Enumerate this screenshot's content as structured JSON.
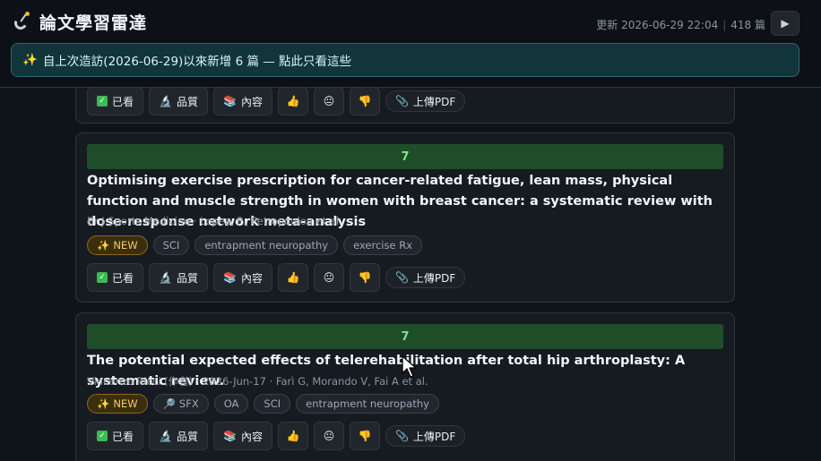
{
  "app": {
    "title": "論文學習雷達",
    "updated": "更新 2026-06-29 22:04",
    "count": "418 篇",
    "play_symbol": "▶"
  },
  "banner": {
    "icon": "✨",
    "text": "自上次造訪(2026-06-29)以來新增 6 篇 — 點此只看這些"
  },
  "actions": {
    "seen": "已看",
    "quality": "品質",
    "content": "內容",
    "upload_pdf": "上傳PDF"
  },
  "cards": [
    {
      "score": "",
      "title": "",
      "authors": "",
      "tags": []
    },
    {
      "score": "7",
      "title": "Optimising exercise prescription for cancer-related fatigue, lean mass, physical function and muscle strength in women with breast cancer: a systematic review with dose-response network meta-analysis",
      "authors": "Br J Sports Medicine · Lopez, P., Petropoulou et al.",
      "tags": [
        {
          "label": "NEW",
          "icon": "✨",
          "kind": "new"
        },
        {
          "label": "SCI"
        },
        {
          "label": "entrapment neuropathy"
        },
        {
          "label": "exercise Rx"
        }
      ]
    },
    {
      "score": "7",
      "title": "The potential expected effects of telerehabilitation after total hip arthroplasty: A systematic review.",
      "authors": "Vincenzo Ricci (作者) · 2026-Jun-17 · Farì G, Morando V, Fai A et al.",
      "tags": [
        {
          "label": "NEW",
          "icon": "✨",
          "kind": "new"
        },
        {
          "label": "SFX",
          "icon": "🔎"
        },
        {
          "label": "OA"
        },
        {
          "label": "SCI"
        },
        {
          "label": "entrapment neuropathy"
        }
      ]
    }
  ],
  "colors": {
    "background": "#0f131a",
    "card": "#161b22",
    "score_bar": "#1f4d2a",
    "score_text": "#7ee787",
    "banner_bg": "#12343b",
    "new_tag": "#f2cc60"
  },
  "icons": {
    "brand": "satellite-dish-icon",
    "seen": "check-icon",
    "quality": "microscope-icon",
    "content": "books-icon",
    "like": "thumbs-up-icon",
    "neutral": "neutral-face-icon",
    "dislike": "thumbs-down-icon",
    "pdf": "paperclip-icon"
  }
}
